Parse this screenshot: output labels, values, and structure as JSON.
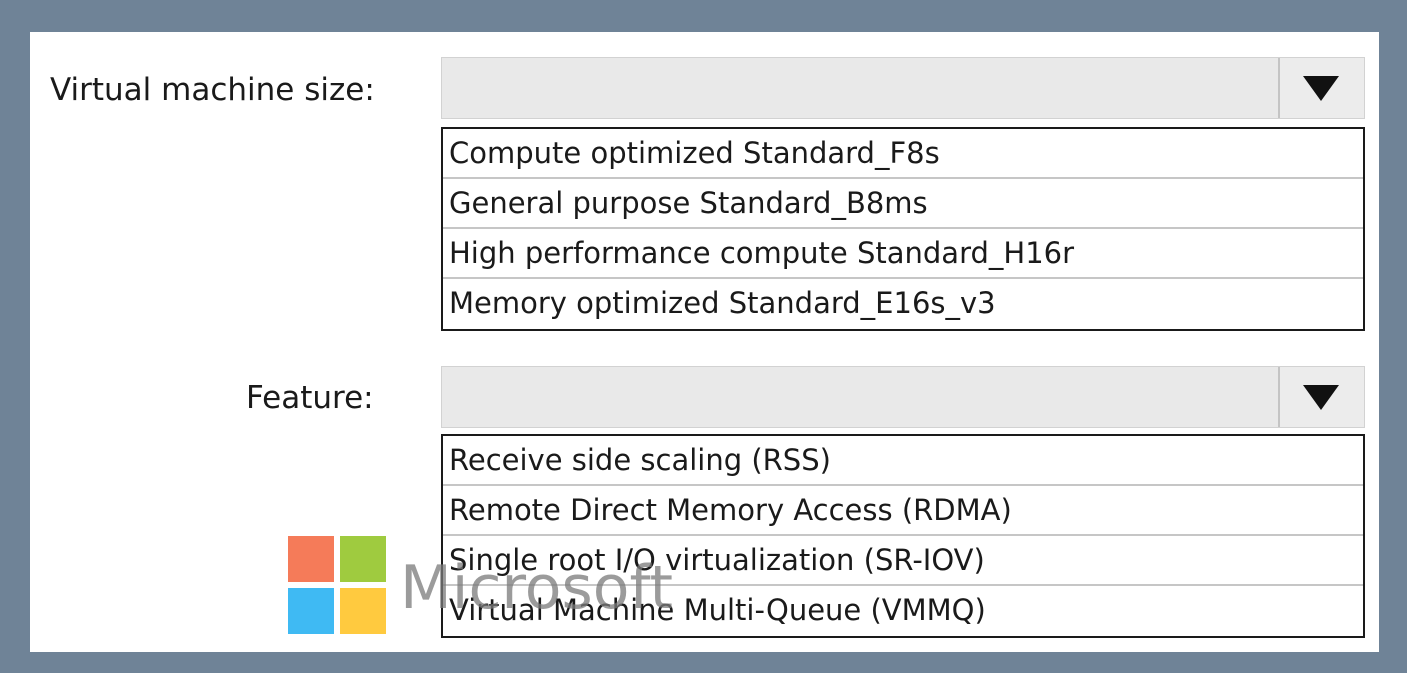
{
  "vm_size": {
    "label": "Virtual machine size:",
    "selected": "",
    "options": [
      "Compute optimized Standard_F8s",
      "General purpose Standard_B8ms",
      "High performance compute Standard_H16r",
      "Memory optimized Standard_E16s_v3"
    ]
  },
  "feature": {
    "label": "Feature:",
    "selected": "",
    "options": [
      "Receive side scaling (RSS)",
      "Remote Direct Memory Access (RDMA)",
      "Single root I/O virtualization (SR-IOV)",
      "Virtual Machine Multi-Queue (VMMQ)"
    ]
  },
  "logo": {
    "text": "Microsoft",
    "colors": [
      "#f25022",
      "#7fba00",
      "#00a4ef",
      "#ffb900"
    ]
  },
  "colors": {
    "frame": "#6f8397",
    "dropdown_bg": "#e9e9e9",
    "option_border": "#1a1a1a"
  },
  "icons": {
    "dropdown": "chevron-down-icon"
  }
}
